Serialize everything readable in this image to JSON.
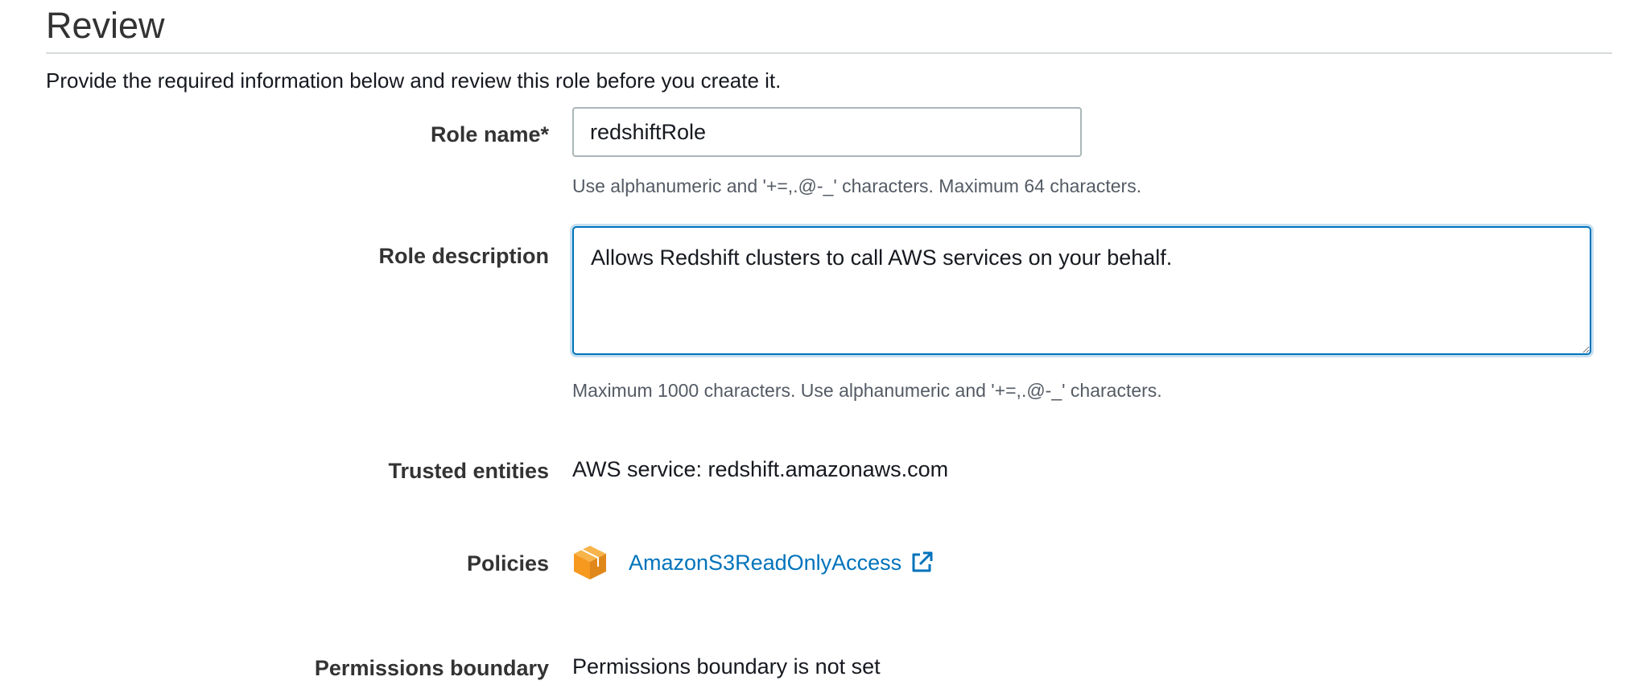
{
  "page": {
    "title": "Review",
    "subtitle": "Provide the required information below and review this role before you create it."
  },
  "role_name": {
    "label": "Role name*",
    "value": "redshiftRole",
    "hint": "Use alphanumeric and '+=,.@-_' characters. Maximum 64 characters."
  },
  "role_description": {
    "label": "Role description",
    "value": "Allows Redshift clusters to call AWS services on your behalf.",
    "hint": "Maximum 1000 characters. Use alphanumeric and '+=,.@-_' characters."
  },
  "trusted_entities": {
    "label": "Trusted entities",
    "value": "AWS service: redshift.amazonaws.com"
  },
  "policies": {
    "label": "Policies",
    "items": [
      {
        "name": "AmazonS3ReadOnlyAccess",
        "icon": "aws-policy-cube-icon",
        "link_icon": "external-link-icon"
      }
    ]
  },
  "permissions_boundary": {
    "label": "Permissions boundary",
    "value": "Permissions boundary is not set"
  },
  "colors": {
    "link": "#0073bb",
    "focus_border": "#0073bb",
    "cube_orange": "#f7981f"
  }
}
